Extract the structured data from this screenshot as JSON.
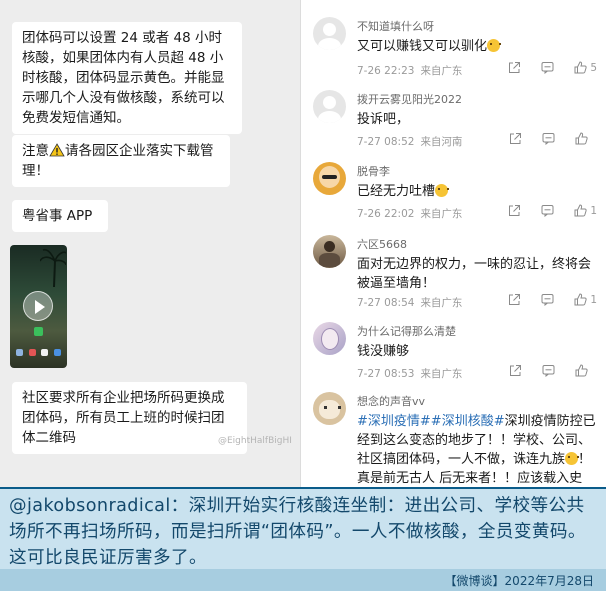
{
  "left_chat": {
    "messages": [
      "团体码可以设置 24 或者 48 小时核酸，如果团体内有人员超 48 小时核酸，团体码显示黄色。并能显示哪几个人没有做核酸，系统可以免费发短信通知。",
      "请各园区企业落实下载管理！",
      "粤省事 APP",
      "社区要求所有企业把场所码更换成团体码，所有员工上班的时候扫团体二维码"
    ],
    "notice_prefix": "注意",
    "warning_icon": "warning-icon",
    "video_icons": [
      "play-icon"
    ],
    "watermark": "@EightHalfBigHI"
  },
  "comments": [
    {
      "user": "不知道填什么呀",
      "text": "又可以赚钱又可以驯化",
      "emoji": true,
      "time": "7-26 22:23",
      "location": "来自广东",
      "likes": "5",
      "avatar": "default-avatar"
    },
    {
      "user": "拨开云雾见阳光2022",
      "text": "投诉吧，",
      "emoji": false,
      "time": "7-27 08:52",
      "location": "来自河南",
      "likes": "",
      "avatar": "default-avatar"
    },
    {
      "user": "脱骨李",
      "text": "已经无力吐槽",
      "emoji": true,
      "time": "7-26 22:02",
      "location": "来自广东",
      "likes": "1",
      "avatar": "bald-avatar"
    },
    {
      "user": "六区5668",
      "text": "面对无边界的权力，一味的忍让，终将会被逼至墙角！",
      "emoji": false,
      "time": "7-27 08:54",
      "location": "来自广东",
      "likes": "1",
      "avatar": "photo-avatar"
    },
    {
      "user": "为什么记得那么清楚",
      "text": "钱没赚够",
      "emoji": false,
      "time": "7-27 08:53",
      "location": "来自广东",
      "likes": "",
      "avatar": "art-avatar"
    },
    {
      "user": "想念的声音vv",
      "text_tags": [
        "#深圳疫情#",
        "#深圳核酸#"
      ],
      "text": "深圳疫情防控已经到这么变态的地步了！！学校、公司、社区搞团体码，一人不做，诛连九族",
      "text_tail": "！真是前无古人 后无来者！！应该载入史册！！",
      "emoji": true,
      "time": "",
      "location": "",
      "likes": "",
      "avatar": "cat-avatar"
    }
  ],
  "action_icons": [
    "share-icon",
    "comment-icon",
    "like-icon"
  ],
  "caption": {
    "text": "@jakobsonradical：深圳开始实行核酸连坐制：进出公司、学校等公共场所不再扫场所码，而是扫所谓“团体码”。一人不做核酸，全员变黄码。这可比良民证厉害多了。",
    "footer": "【微博谈】2022年7月28日"
  },
  "colors": {
    "accent": "#2b6fb6",
    "caption_bg": "#c9e2ef",
    "caption_text": "#13486b"
  }
}
